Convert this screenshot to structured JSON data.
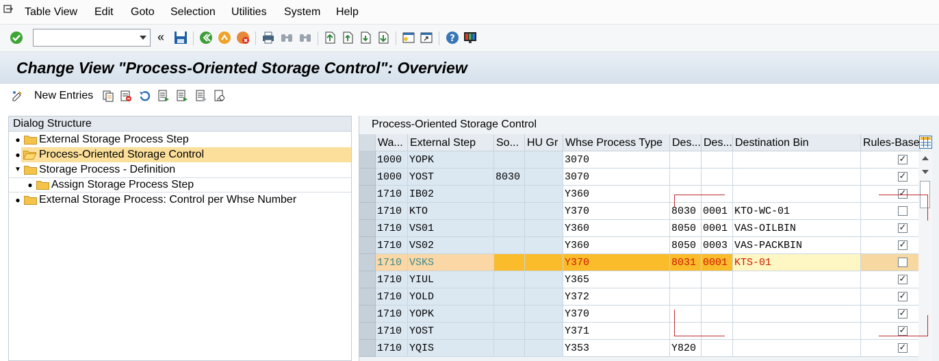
{
  "menu": [
    "Table View",
    "Edit",
    "Goto",
    "Selection",
    "Utilities",
    "System",
    "Help"
  ],
  "toolbar": {
    "command_field_value": "",
    "history_glyph": "«"
  },
  "title": "Change View \"Process-Oriented Storage Control\": Overview",
  "app_toolbar": {
    "new_entries": "New Entries"
  },
  "dialog_structure": {
    "header": "Dialog Structure",
    "nodes": [
      {
        "label": "External Storage Process Step",
        "selected": false,
        "icon": "folder-icon"
      },
      {
        "label": "Process-Oriented Storage Control",
        "selected": true,
        "icon": "folder-open-icon"
      },
      {
        "label": "Storage Process - Definition",
        "selected": false,
        "icon": "folder-icon"
      },
      {
        "label": "Assign Storage Process Step",
        "selected": false,
        "icon": "folder-icon"
      },
      {
        "label": "External Storage Process: Control per Whse Number",
        "selected": false,
        "icon": "folder-icon"
      }
    ]
  },
  "table": {
    "title": "Process-Oriented Storage Control",
    "columns": [
      "Wa...",
      "External Step",
      "So...",
      "HU Gr",
      "Whse Process Type",
      "Des...",
      "Des...",
      "Destination Bin",
      "Rules-Based"
    ],
    "rows": [
      {
        "wh": "1000",
        "step": "YOPK",
        "so": "",
        "hu": "",
        "wpt": "3070",
        "des1": "",
        "des2": "",
        "bin": "",
        "rules": true
      },
      {
        "wh": "1000",
        "step": "YOST",
        "so": "8030",
        "hu": "",
        "wpt": "3070",
        "des1": "",
        "des2": "",
        "bin": "",
        "rules": true
      },
      {
        "wh": "1710",
        "step": "IB02",
        "so": "",
        "hu": "",
        "wpt": "Y360",
        "des1": "",
        "des2": "",
        "bin": "",
        "rules": true
      },
      {
        "wh": "1710",
        "step": "KTO",
        "so": "",
        "hu": "",
        "wpt": "Y370",
        "des1": "8030",
        "des2": "0001",
        "bin": "KTO-WC-01",
        "rules": false
      },
      {
        "wh": "1710",
        "step": "VS01",
        "so": "",
        "hu": "",
        "wpt": "Y360",
        "des1": "8050",
        "des2": "0001",
        "bin": "VAS-OILBIN",
        "rules": true
      },
      {
        "wh": "1710",
        "step": "VS02",
        "so": "",
        "hu": "",
        "wpt": "Y360",
        "des1": "8050",
        "des2": "0003",
        "bin": "VAS-PACKBIN",
        "rules": true
      },
      {
        "wh": "1710",
        "step": "VSKS",
        "so": "",
        "hu": "",
        "wpt": "Y370",
        "des1": "8031",
        "des2": "0001",
        "bin": "KTS-01",
        "rules": false
      },
      {
        "wh": "1710",
        "step": "YIUL",
        "so": "",
        "hu": "",
        "wpt": "Y365",
        "des1": "",
        "des2": "",
        "bin": "",
        "rules": true
      },
      {
        "wh": "1710",
        "step": "YOLD",
        "so": "",
        "hu": "",
        "wpt": "Y372",
        "des1": "",
        "des2": "",
        "bin": "",
        "rules": true
      },
      {
        "wh": "1710",
        "step": "YOPK",
        "so": "",
        "hu": "",
        "wpt": "Y370",
        "des1": "",
        "des2": "",
        "bin": "",
        "rules": true
      },
      {
        "wh": "1710",
        "step": "YOST",
        "so": "",
        "hu": "",
        "wpt": "Y371",
        "des1": "",
        "des2": "",
        "bin": "",
        "rules": true
      },
      {
        "wh": "1710",
        "step": "YQIS",
        "so": "",
        "hu": "",
        "wpt": "Y353",
        "des1": "Y820",
        "des2": "",
        "bin": "",
        "rules": true
      }
    ],
    "highlighted_row": 6
  },
  "colors": {
    "highlight": "#fbbc2c",
    "key_column": "#dbe8f2",
    "selected_tree": "#fbdf9a",
    "annotation_red": "#c0272d"
  }
}
